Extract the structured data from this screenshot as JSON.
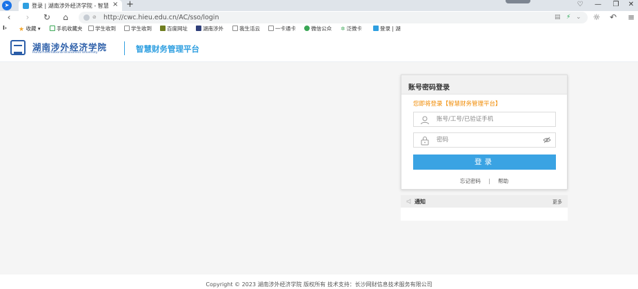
{
  "browser": {
    "tab_title": "登录 | 湖南涉外经济学院 - 智慧",
    "url": "http://cwc.hieu.edu.cn/AC/sso/login"
  },
  "bookmarks": [
    {
      "label": "收藏",
      "icon": "star-icon"
    },
    {
      "label": "手机收藏夹",
      "icon": "phone-icon"
    },
    {
      "label": "学生收到",
      "icon": "folder-icon"
    },
    {
      "label": "学生收到",
      "icon": "folder-icon"
    },
    {
      "label": "百度网址",
      "icon": "shield-icon"
    },
    {
      "label": "湖南涉外",
      "icon": "school-icon"
    },
    {
      "label": "我生活云",
      "icon": "folder-icon"
    },
    {
      "label": "一卡通卡",
      "icon": "folder-icon"
    },
    {
      "label": "微信公众",
      "icon": "wechat-icon"
    },
    {
      "label": "泛微卡",
      "icon": "gear-icon"
    },
    {
      "label": "登录 | 湖",
      "icon": "site-icon"
    }
  ],
  "header": {
    "school_name": "湖南涉外经济学院",
    "school_subtitle": "Hunan International Economics University",
    "platform_name": "智慧财务管理平台"
  },
  "login": {
    "title": "账号密码登录",
    "notice": "您即将登录【智慧财务管理平台】",
    "account_placeholder": "账号/工号/已验证手机",
    "password_placeholder": "密码",
    "submit_label": "登录",
    "forgot_label": "忘记密码",
    "separator": "|",
    "help_label": "帮助"
  },
  "notices": {
    "title": "通知",
    "more_label": "更多"
  },
  "footer": {
    "copyright": "Copyright © 2023 湖南涉外经济学院 版权所有 技术支持：长沙网财信息技术服务有限公司"
  }
}
